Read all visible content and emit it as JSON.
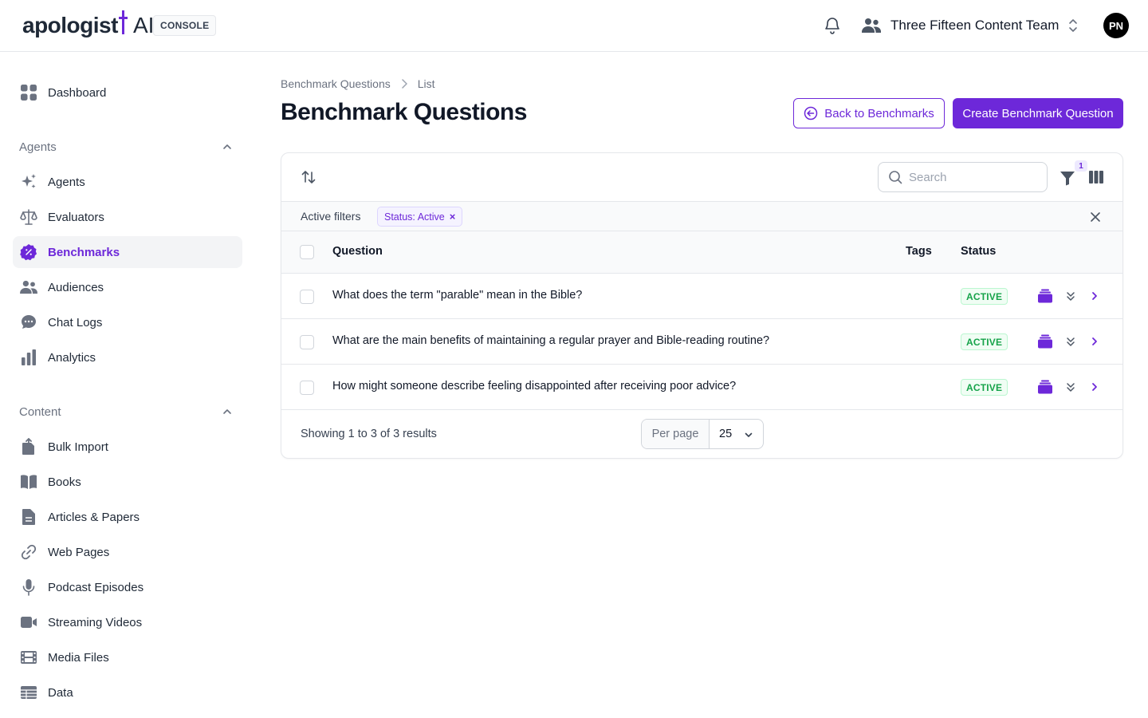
{
  "header": {
    "logo_word": "apologist",
    "logo_ai": "AI",
    "console_badge": "CONSOLE",
    "team_name": "Three Fifteen Content Team",
    "avatar_initials": "PN"
  },
  "sidebar": {
    "dashboard": "Dashboard",
    "agents_group": "Agents",
    "agents_items": [
      "Agents",
      "Evaluators",
      "Benchmarks",
      "Audiences",
      "Chat Logs",
      "Analytics"
    ],
    "content_group": "Content",
    "content_items": [
      "Bulk Import",
      "Books",
      "Articles & Papers",
      "Web Pages",
      "Podcast Episodes",
      "Streaming Videos",
      "Media Files",
      "Data"
    ],
    "active_item": "Benchmarks"
  },
  "breadcrumb": {
    "parent": "Benchmark Questions",
    "current": "List"
  },
  "page": {
    "title": "Benchmark Questions",
    "back_button": "Back to Benchmarks",
    "create_button": "Create Benchmark Question"
  },
  "table": {
    "search_placeholder": "Search",
    "filter_count": "1",
    "active_filters_label": "Active filters",
    "filter_chip": "Status: Active",
    "filter_chip_remove": "×",
    "columns": {
      "question": "Question",
      "tags": "Tags",
      "status": "Status"
    },
    "rows": [
      {
        "question": "What does the term \"parable\" mean in the Bible?",
        "status": "ACTIVE"
      },
      {
        "question": "What are the main benefits of maintaining a regular prayer and Bible-reading routine?",
        "status": "ACTIVE"
      },
      {
        "question": "How might someone describe feeling disappointed after receiving poor advice?",
        "status": "ACTIVE"
      }
    ],
    "footer_text": "Showing 1 to 3 of 3 results",
    "per_page_label": "Per page",
    "per_page_value": "25"
  },
  "colors": {
    "brand": "#6d28d9",
    "active_status": "#16a34a"
  }
}
